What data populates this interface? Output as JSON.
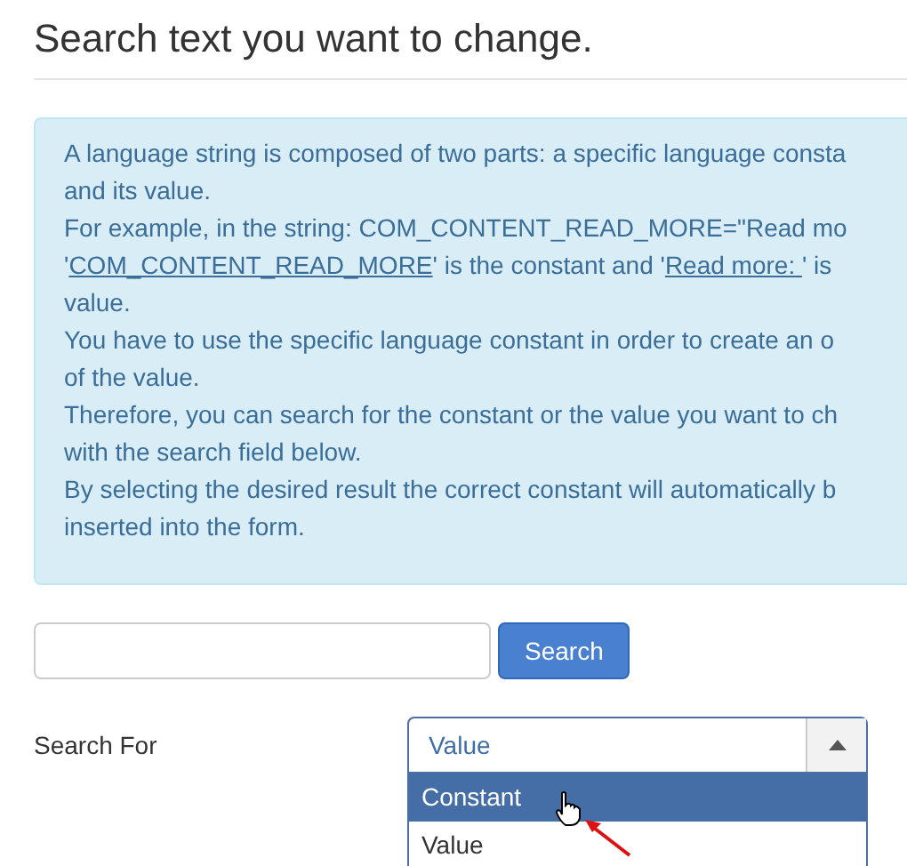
{
  "heading": "Search text you want to change.",
  "info_lines": [
    [
      {
        "text": "A language string is composed of two parts: a specific language consta",
        "underline": false
      }
    ],
    [
      {
        "text": "and its value.",
        "underline": false
      }
    ],
    [
      {
        "text": "For example, in the string: COM_CONTENT_READ_MORE=\"Read mo",
        "underline": false
      }
    ],
    [
      {
        "text": "'",
        "underline": false
      },
      {
        "text": "COM_CONTENT_READ_MORE",
        "underline": true
      },
      {
        "text": "' is the constant and '",
        "underline": false
      },
      {
        "text": "Read more: ",
        "underline": true
      },
      {
        "text": "' is",
        "underline": false
      }
    ],
    [
      {
        "text": "value.",
        "underline": false
      }
    ],
    [
      {
        "text": "You have to use the specific language constant in order to create an o",
        "underline": false
      }
    ],
    [
      {
        "text": "of the value.",
        "underline": false
      }
    ],
    [
      {
        "text": "Therefore, you can search for the constant or the value you want to ch",
        "underline": false
      }
    ],
    [
      {
        "text": "with the search field below.",
        "underline": false
      }
    ],
    [
      {
        "text": "By selecting the desired result the correct constant will automatically b",
        "underline": false
      }
    ],
    [
      {
        "text": "inserted into the form.",
        "underline": false
      }
    ]
  ],
  "search_button": "Search",
  "search_for": {
    "label": "Search For",
    "value": "Value",
    "expanded": true,
    "options": [
      {
        "label": "Constant",
        "highlighted": true
      },
      {
        "label": "Value",
        "highlighted": false
      }
    ]
  }
}
